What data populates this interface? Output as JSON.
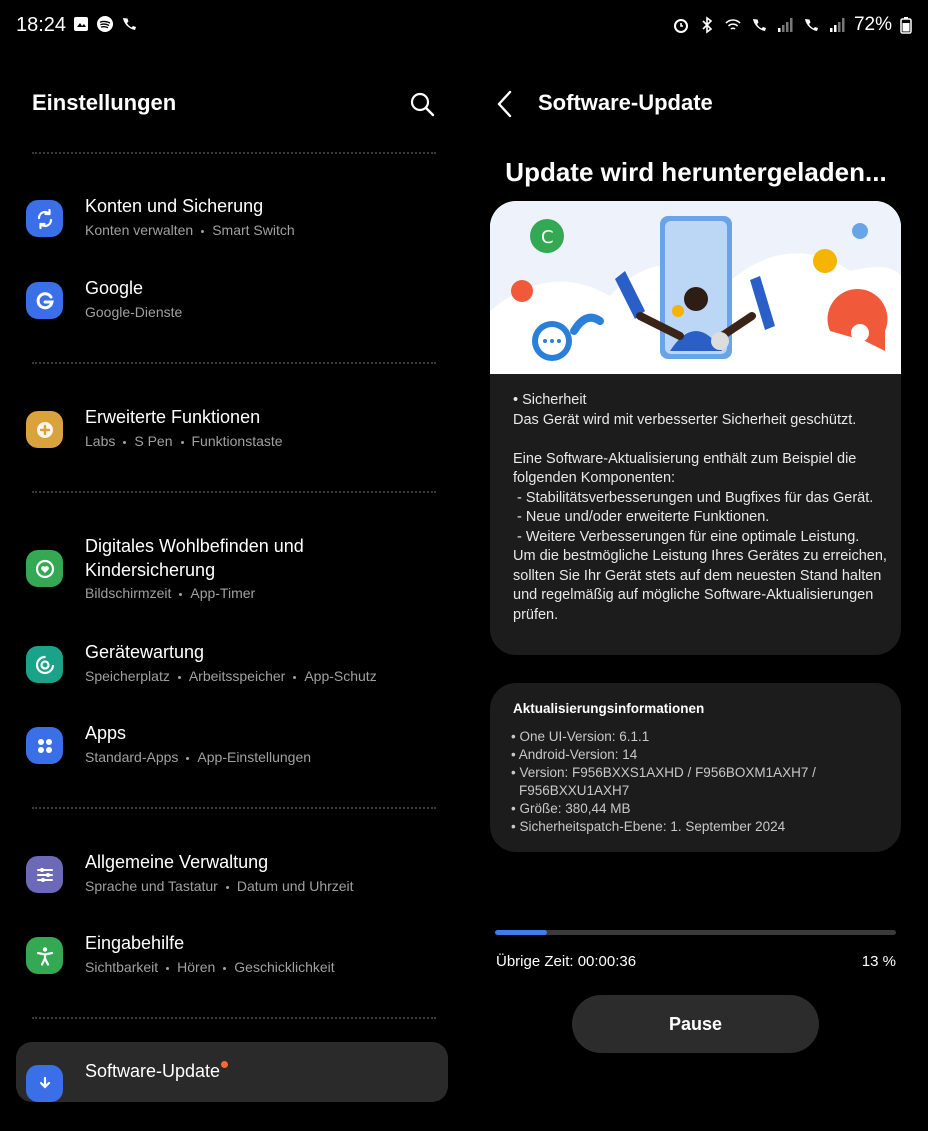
{
  "status_bar": {
    "time": "18:24",
    "battery": "72%"
  },
  "left_pane": {
    "title": "Einstellungen",
    "items": [
      {
        "title": "Konten und Sicherung",
        "subs": [
          "Konten verwalten",
          "Smart Switch"
        ],
        "icon": "sync-icon",
        "color": "#3b6fe8"
      },
      {
        "title": "Google",
        "subs": [
          "Google-Dienste"
        ],
        "icon": "google-icon",
        "color": "#3b6fe8"
      },
      {
        "title": "Erweiterte Funktionen",
        "subs": [
          "Labs",
          "S Pen",
          "Funktionstaste"
        ],
        "icon": "puzzle-plus-icon",
        "color": "#d9a23c"
      },
      {
        "title_line1": "Digitales Wohlbefinden und",
        "title_line2": "Kindersicherung",
        "subs": [
          "Bildschirmzeit",
          "App-Timer"
        ],
        "icon": "wellbeing-icon",
        "color": "#34a853"
      },
      {
        "title": "Gerätewartung",
        "subs": [
          "Speicherplatz",
          "Arbeitsspeicher",
          "App-Schutz"
        ],
        "icon": "device-care-icon",
        "color": "#1aa389"
      },
      {
        "title": "Apps",
        "subs": [
          "Standard-Apps",
          "App-Einstellungen"
        ],
        "icon": "apps-grid-icon",
        "color": "#3b6fe8"
      },
      {
        "title": "Allgemeine Verwaltung",
        "subs": [
          "Sprache und Tastatur",
          "Datum und Uhrzeit"
        ],
        "icon": "sliders-icon",
        "color": "#6c6ab8"
      },
      {
        "title": "Eingabehilfe",
        "subs": [
          "Sichtbarkeit",
          "Hören",
          "Geschicklichkeit"
        ],
        "icon": "accessibility-icon",
        "color": "#34a853"
      },
      {
        "title": "Software-Update",
        "icon": "software-update-icon",
        "color": "#3b6fe8"
      }
    ]
  },
  "right_pane": {
    "title": "Software-Update",
    "heading": "Update wird heruntergeladen...",
    "description": [
      "• Sicherheit",
      "Das Gerät wird mit verbesserter Sicherheit geschützt.",
      "",
      "Eine Software-Aktualisierung enthält zum Beispiel die folgenden Komponenten:",
      " - Stabilitätsverbesserungen und Bugfixes für das Gerät.",
      " - Neue und/oder erweiterte Funktionen.",
      " - Weitere Verbesserungen für eine optimale Leistung.",
      "Um die bestmögliche Leistung Ihres Gerätes zu erreichen, sollten Sie Ihr Gerät stets auf dem neuesten Stand halten und regelmäßig auf mögliche Software-Aktualisierungen prüfen."
    ],
    "info_title": "Aktualisierungsinformationen",
    "info": [
      "• One UI-Version: 6.1.1",
      "• Android-Version: 14",
      "• Version: F956BXXS1AXHD / F956BOXM1AXH7 / F956BXXU1AXH7",
      "• Größe: 380,44 MB",
      "• Sicherheitspatch-Ebene: 1. September 2024"
    ],
    "progress_fraction": 0.13,
    "remaining_time": "Übrige Zeit: 00:00:36",
    "percent": "13 %",
    "pause_label": "Pause"
  }
}
